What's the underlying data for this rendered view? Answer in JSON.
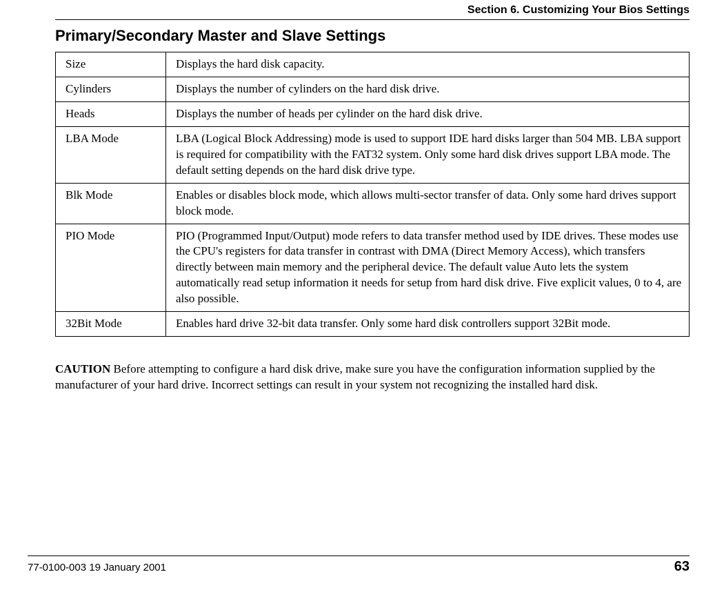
{
  "header": {
    "running_head": "Section 6. Customizing Your Bios Settings",
    "title": "Primary/Secondary Master and Slave Settings"
  },
  "table": {
    "rows": [
      {
        "name": "Size",
        "desc": "Displays the hard disk capacity."
      },
      {
        "name": "Cylinders",
        "desc": "Displays the number of cylinders on the hard disk drive."
      },
      {
        "name": "Heads",
        "desc": "Displays the number of heads per cylinder on the hard disk drive."
      },
      {
        "name": "LBA Mode",
        "desc": "LBA (Logical Block Addressing) mode is used to support IDE hard disks larger than 504 MB. LBA support is required for compatibility with the FAT32 system. Only some hard disk drives support LBA mode. The default setting depends on the hard disk drive type."
      },
      {
        "name": "Blk Mode",
        "desc": "Enables or disables block mode, which allows multi-sector transfer of data. Only some hard drives support block mode."
      },
      {
        "name": "PIO Mode",
        "desc": "PIO (Programmed Input/Output) mode refers to data transfer method used by IDE drives. These modes use the CPU's registers for data transfer in contrast with DMA (Direct Memory Access), which transfers directly between main memory and the peripheral device. The default value Auto lets the system automatically read setup information it needs for setup from hard disk drive. Five explicit values, 0 to 4, are also possible."
      },
      {
        "name": "32Bit Mode",
        "desc": "Enables hard drive 32-bit data transfer. Only some hard disk controllers support 32Bit mode."
      }
    ]
  },
  "caution": {
    "label": "CAUTION",
    "text": "  Before attempting to configure a hard disk drive, make sure you have the configuration information supplied by the manufacturer of your hard drive.  Incorrect settings can result in your system not recognizing the installed hard disk."
  },
  "footer": {
    "doc_id": "77-0100-003   19 January 2001",
    "page_number": "63"
  }
}
